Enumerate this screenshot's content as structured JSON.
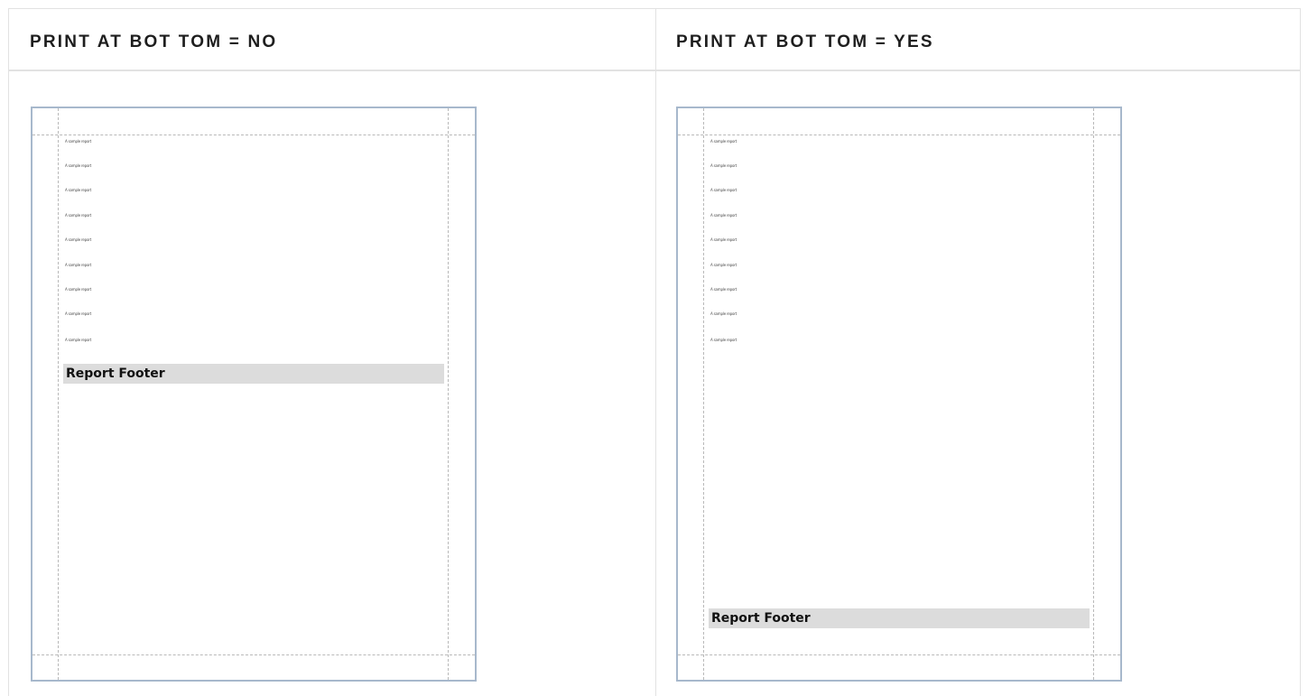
{
  "columns": [
    {
      "header": "PRINT AT BOT TOM = NO",
      "detail_rows": [
        "A sample report",
        "A sample report",
        "A sample report",
        "A sample report",
        "A sample report",
        "A sample report",
        "A sample report",
        "A sample report",
        "A sample report"
      ],
      "footer_label": "Report Footer"
    },
    {
      "header": "PRINT AT BOT TOM = YES",
      "detail_rows": [
        "A sample report",
        "A sample report",
        "A sample report",
        "A sample report",
        "A sample report",
        "A sample report",
        "A sample report",
        "A sample report",
        "A sample report"
      ],
      "footer_label": "Report Footer"
    }
  ],
  "colors": {
    "page_border": "#a7b8cc",
    "footer_band": "#dcdcdc",
    "guide": "#b9b9b9"
  }
}
